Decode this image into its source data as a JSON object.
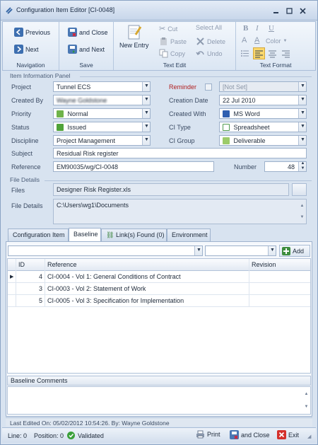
{
  "window": {
    "title": "Configuration Item Editor [CI-0048]"
  },
  "ribbon": {
    "navigation": {
      "label": "Navigation",
      "previous": "Previous",
      "next": "Next"
    },
    "save": {
      "label": "Save",
      "and_close": "and Close",
      "and_next": "and Next"
    },
    "text_edit": {
      "label": "Text Edit",
      "new_entry": "New Entry",
      "cut": "Cut",
      "paste": "Paste",
      "copy": "Copy",
      "select_all": "Select All",
      "delete": "Delete",
      "undo": "Undo"
    },
    "text_format": {
      "label": "Text Format",
      "bold": "B",
      "italic": "I",
      "underline": "U",
      "color": "Color"
    }
  },
  "info": {
    "panel_label": "Item Information Panel",
    "project_label": "Project",
    "project": "Tunnel ECS",
    "reminder_label": "Reminder",
    "reminder": "[Not Set]",
    "created_by_label": "Created By",
    "created_by": "Wayne Goldstone",
    "creation_date_label": "Creation Date",
    "creation_date": "22 Jul 2010",
    "priority_label": "Priority",
    "priority": "Normal",
    "created_with_label": "Created With",
    "created_with": "MS Word",
    "status_label": "Status",
    "status": "Issued",
    "ci_type_label": "CI Type",
    "ci_type": "Spreadsheet",
    "discipline_label": "Discipline",
    "discipline": "Project Management",
    "ci_group_label": "CI Group",
    "ci_group": "Deliverable",
    "subject_label": "Subject",
    "subject": "Residual Risk register",
    "reference_label": "Reference",
    "reference": "EM90035/wg/CI-0048",
    "number_label": "Number",
    "number": "48"
  },
  "file_details": {
    "panel_label": "File Details",
    "files_label": "Files",
    "files": "Designer Risk Register.xls",
    "details_label": "File Details",
    "details": "C:\\Users\\wg1\\Documents"
  },
  "tabs": [
    {
      "label": "Configuration Item"
    },
    {
      "label": "Baseline"
    },
    {
      "label": "Link(s) Found (0)"
    },
    {
      "label": "Environment"
    }
  ],
  "baseline": {
    "add_label": "Add",
    "columns": {
      "id": "ID",
      "reference": "Reference",
      "revision": "Revision"
    },
    "rows": [
      {
        "id": "4",
        "reference": "CI-0004 - Vol 1: General Conditions of Contract",
        "revision": ""
      },
      {
        "id": "3",
        "reference": "CI-0003 - Vol 2: Statement of Work",
        "revision": ""
      },
      {
        "id": "5",
        "reference": "CI-0005 - Vol 3: Specification for Implementation",
        "revision": ""
      }
    ],
    "comments_label": "Baseline Comments"
  },
  "footer": {
    "last_edited": "Last Edited On: 05/02/2012 10:54:26. By: Wayne Goldstone"
  },
  "status": {
    "line": "Line: 0",
    "position": "Position: 0",
    "validated": "Validated",
    "print": "Print",
    "and_close": "and Close",
    "exit": "Exit"
  }
}
